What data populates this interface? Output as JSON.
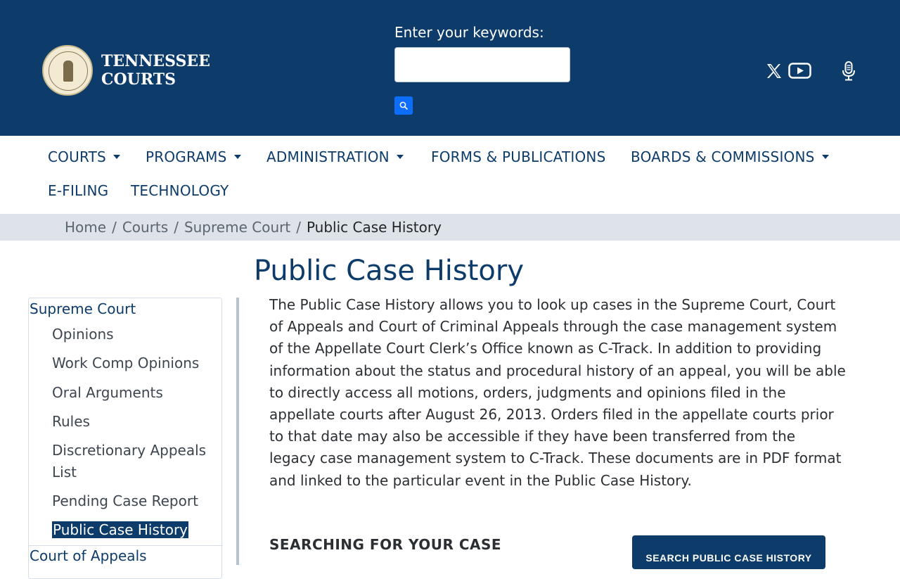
{
  "header": {
    "logo_line1": "TENNESSEE",
    "logo_line2": "COURTS",
    "search_label": "Enter your keywords:",
    "search_value": ""
  },
  "nav": {
    "items": [
      {
        "label": "COURTS"
      },
      {
        "label": "PROGRAMS"
      },
      {
        "label": "ADMINISTRATION"
      },
      {
        "label": "FORMS & PUBLICATIONS"
      },
      {
        "label": "BOARDS & COMMISSIONS"
      },
      {
        "label": "E-FILING"
      },
      {
        "label": "TECHNOLOGY"
      }
    ]
  },
  "breadcrumb": {
    "items": [
      "Home",
      "Courts",
      "Supreme Court"
    ],
    "current": "Public Case History",
    "separator": "/"
  },
  "page": {
    "title": "Public Case History",
    "intro": "The Public Case History allows you to look up cases in the Supreme Court, Court of Appeals and Court of Criminal Appeals through the case management system of the Appellate Court Clerk’s Office known as C-Track. In addition to providing information about the status and procedural history of an appeal, you will be able to directly access all motions, orders, judgments and opinions filed in the appellate courts after August 26, 2013. Orders filed in the appellate courts prior to that date may also be accessible if they have been transferred from the legacy case management system to C-Track. These documents are in PDF format and linked to the particular event in the Public Case History.",
    "section_heading": "SEARCHING FOR YOUR CASE",
    "cta_label": "SEARCH PUBLIC CASE HISTORY"
  },
  "sidebar": {
    "section1": "Supreme Court",
    "items": [
      "Opinions",
      "Work Comp Opinions",
      "Oral Arguments",
      "Rules",
      "Discretionary Appeals List",
      "Pending Case Report",
      "Public Case History"
    ],
    "section2": "Court of Appeals"
  },
  "colors": {
    "header_bg": "#0d3c6b",
    "breadcrumb_bg": "#dde3e9",
    "accent": "#0d6efd"
  },
  "icons": {
    "search": "search-icon",
    "x": "x-logo-icon",
    "youtube": "youtube-icon",
    "mic": "microphone-icon"
  }
}
